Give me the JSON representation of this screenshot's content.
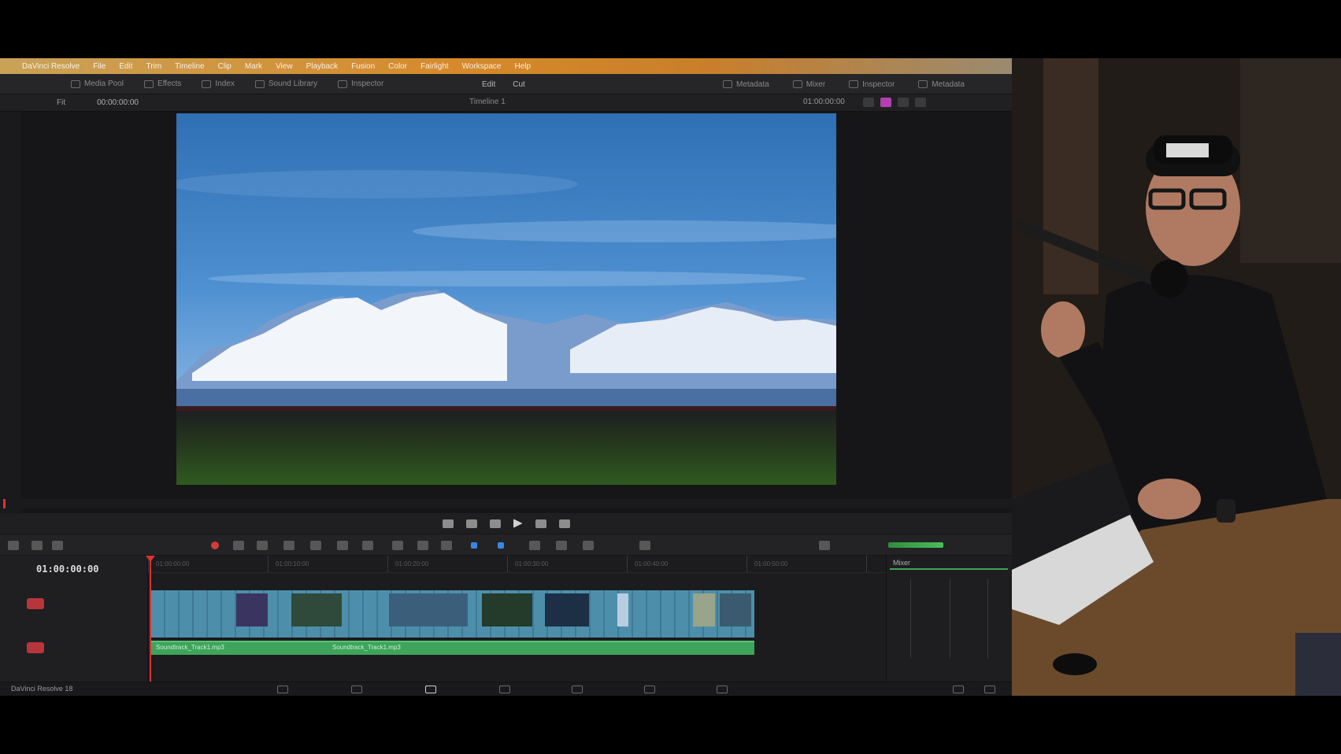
{
  "app": {
    "menu": [
      "DaVinci Resolve",
      "File",
      "Edit",
      "Trim",
      "Timeline",
      "Clip",
      "Mark",
      "View",
      "Playback",
      "Fusion",
      "Color",
      "Fairlight",
      "Workspace",
      "Help"
    ],
    "toolbar_left": [
      "Media Pool",
      "Effects",
      "Index",
      "Sound Library",
      "Inspector"
    ],
    "toolbar_center": [
      "Edit",
      "Cut"
    ],
    "toolbar_right": [
      "Metadata",
      "Mixer",
      "Inspector",
      "Metadata"
    ],
    "zoom_label": "Fit",
    "source_timecode": "00:00:00:00",
    "clip_name": "Timeline 1",
    "viewer_timecode": "01:00:00:00",
    "timeline_timecode": "01:00:00:00",
    "ruler_labels": [
      "01:00:00:00",
      "01:00:10:00",
      "01:00:20:00",
      "01:00:30:00",
      "01:00:40:00",
      "01:00:50:00"
    ],
    "audio_clip_labels": [
      "Soundtrack_Track1.mp3",
      "Soundtrack_Track1.mp3"
    ],
    "mixer_title": "Mixer",
    "brand": "DaVinci Resolve 18"
  },
  "colors": {
    "menubar_accent": "#d68a2b",
    "video_track": "#4d8fab",
    "audio_track": "#3ea35b",
    "playhead": "#d93434",
    "record_badge": "#b8353b"
  }
}
